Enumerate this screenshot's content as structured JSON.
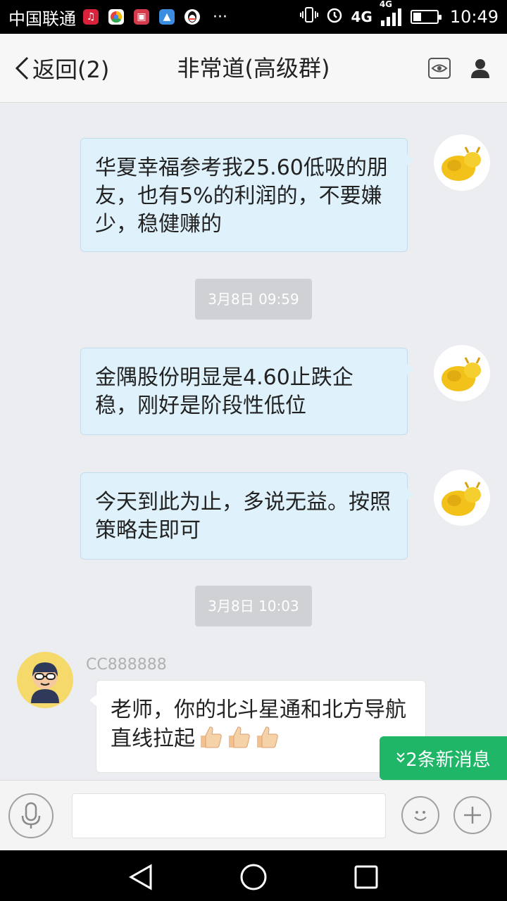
{
  "status_bar": {
    "carrier": "中国联通",
    "network_labels": [
      "4G",
      "4G"
    ],
    "time": "10:49",
    "overflow": "···",
    "battery_level": 0.35,
    "app_icons": [
      "music-app-icon",
      "browser-app-icon",
      "shop-app-icon",
      "gallery-app-icon",
      "qq-app-icon"
    ]
  },
  "header": {
    "back_label": "返回(2)",
    "title": "非常道(高级群)"
  },
  "messages": [
    {
      "side": "right",
      "text": "华夏幸福参考我25.60低吸的朋友，也有5%的利润的，不要嫌少，稳健赚的"
    },
    {
      "side": "right",
      "text": "金隅股份明显是4.60止跌企稳，刚好是阶段性低位"
    },
    {
      "side": "right",
      "text": "今天到此为止，多说无益。按照策略走即可"
    },
    {
      "side": "left",
      "sender": "CC888888",
      "text": "老师，你的北斗星通和北方导航直线拉起"
    }
  ],
  "timestamps": [
    "3月8日 09:59",
    "3月8日 10:03"
  ],
  "new_messages_label": "2条新消息",
  "input": {
    "placeholder": ""
  },
  "colors": {
    "bubble_self": "#dff1fb",
    "new_message_badge": "#1fb668",
    "avatar_gold": "#f2c21a"
  }
}
